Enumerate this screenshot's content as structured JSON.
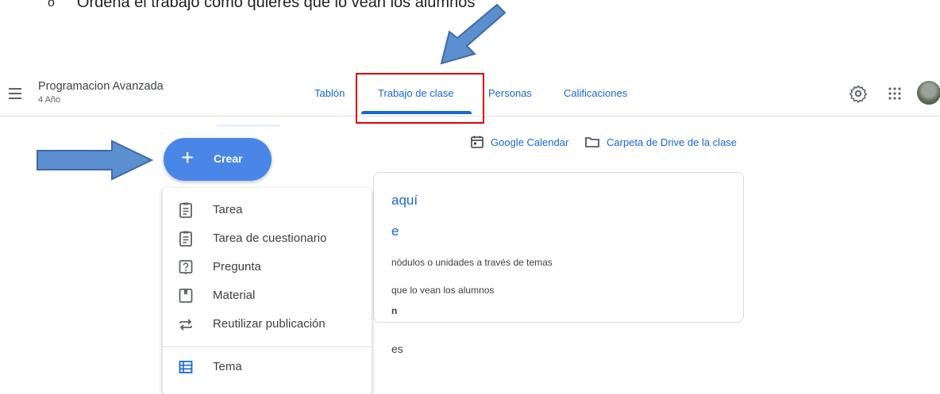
{
  "doc": {
    "bullet": "o",
    "text": "Ordena el trabajo como quieres que lo vean los alumnos"
  },
  "header": {
    "class_title": "Programacion Avanzada",
    "class_subtitle": "4 Año",
    "tabs": [
      {
        "label": "Tablón"
      },
      {
        "label": "Trabajo de clase",
        "active": true
      },
      {
        "label": "Personas"
      },
      {
        "label": "Calificaciones"
      }
    ],
    "icons": [
      "menu-icon",
      "settings-icon",
      "apps-grid-icon",
      "avatar"
    ]
  },
  "create_button": {
    "label": "Crear"
  },
  "links": {
    "calendar": "Google Calendar",
    "drive": "Carpeta de Drive de la clase"
  },
  "background_fragments": {
    "heading": "aquí",
    "subheading": "e",
    "line1": "nódulos o unidades a través de temas",
    "line2": "que lo vean los alumnos",
    "line3": "n",
    "line4": "es"
  },
  "create_menu": {
    "items": [
      {
        "label": "Tarea",
        "icon": "assignment-icon"
      },
      {
        "label": "Tarea de cuestionario",
        "icon": "quiz-assignment-icon"
      },
      {
        "label": "Pregunta",
        "icon": "question-icon"
      },
      {
        "label": "Material",
        "icon": "material-icon"
      },
      {
        "label": "Reutilizar publicación",
        "icon": "reuse-icon"
      },
      {
        "label": "Tema",
        "icon": "topic-icon"
      }
    ]
  },
  "colors": {
    "accent": "#1967d2",
    "create_button": "#4a86e8",
    "annotation_arrow": "#4a7fc1",
    "annotation_box": "#e00000"
  }
}
